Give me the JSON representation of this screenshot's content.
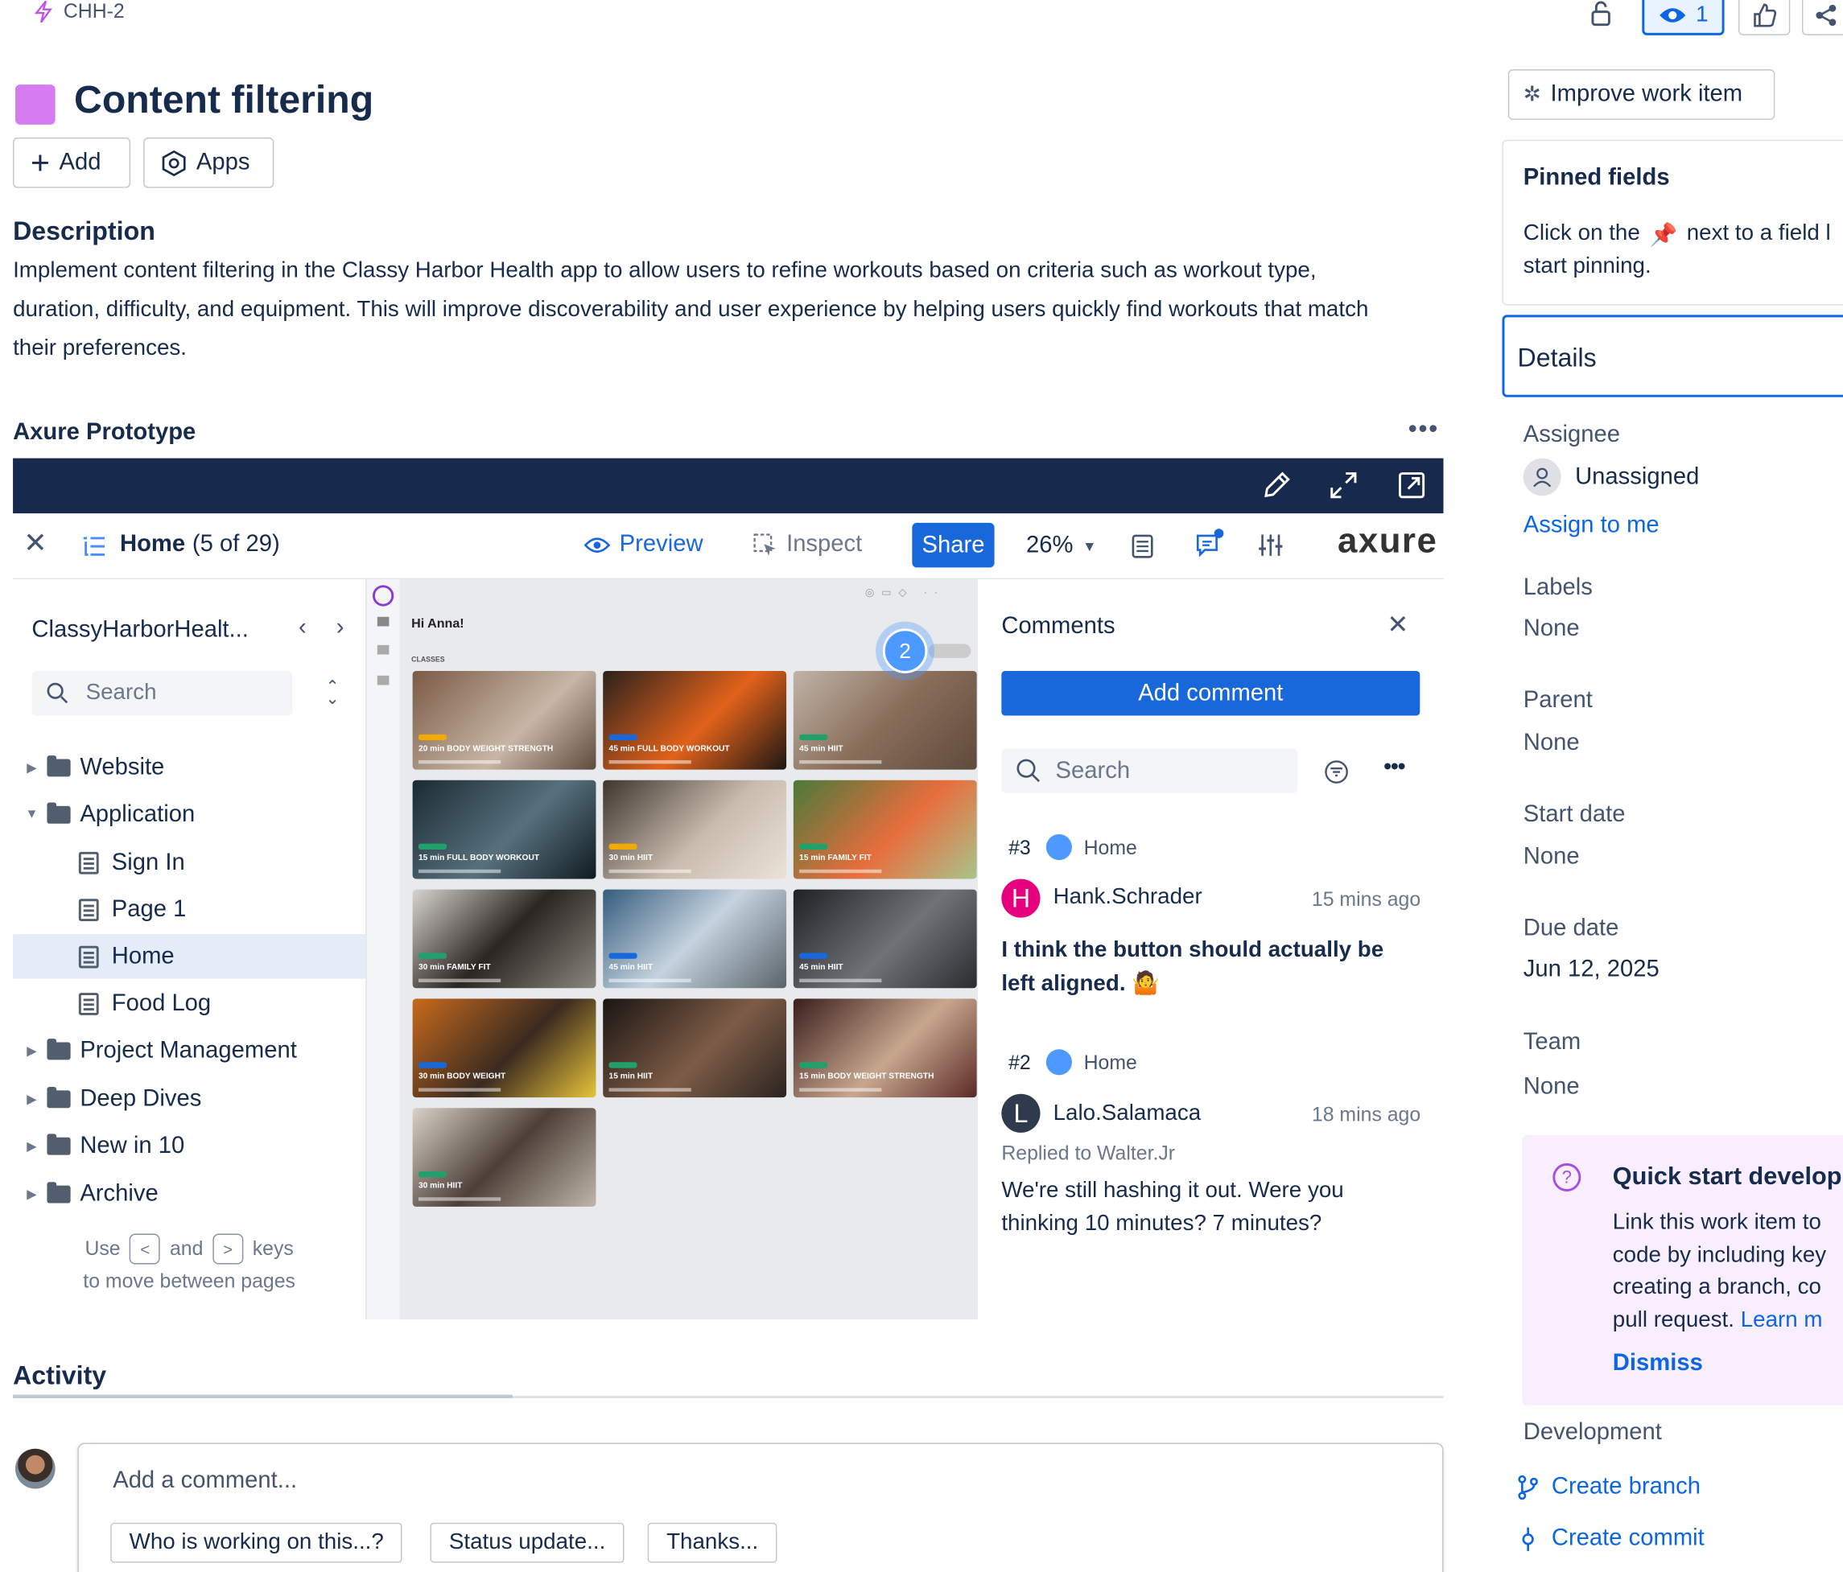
{
  "issue_key": "CHH-2",
  "title": "Content filtering",
  "toolbar": {
    "add_label": "Add",
    "apps_label": "Apps",
    "watch_count": "1",
    "improve_label": "Improve work item"
  },
  "description": {
    "heading": "Description",
    "body": "Implement content filtering in the Classy Harbor Health app to allow users to refine workouts based on criteria such as workout type, duration, difficulty, and equipment. This will improve discoverability and user experience by helping users quickly find workouts that match their preferences."
  },
  "prototype": {
    "heading": "Axure Prototype",
    "page_name": "Home",
    "page_count": "(5 of 29)",
    "preview_label": "Preview",
    "inspect_label": "Inspect",
    "share_label": "Share",
    "zoom": "26%",
    "brand": "axure",
    "project_name": "ClassyHarborHealt...",
    "search_placeholder": "Search",
    "tree": [
      {
        "label": "Website"
      },
      {
        "label": "Application"
      },
      {
        "label": "Sign In"
      },
      {
        "label": "Page 1"
      },
      {
        "label": "Home"
      },
      {
        "label": "Food Log"
      },
      {
        "label": "Project Management"
      },
      {
        "label": "Deep Dives"
      },
      {
        "label": "New in 10"
      },
      {
        "label": "Archive"
      }
    ],
    "hint_use": "Use",
    "hint_and": "and",
    "hint_keys": "keys",
    "hint_line2": "to move between pages",
    "canvas_greeting": "Hi Anna!",
    "canvas_section": "CLASSES",
    "marker_count": "2",
    "tiles": [
      {
        "label": "20 min  BODY WEIGHT STRENGTH"
      },
      {
        "label": "45 min  FULL BODY WORKOUT"
      },
      {
        "label": "45 min  HIIT"
      },
      {
        "label": "15 min  FULL BODY WORKOUT"
      },
      {
        "label": "30 min  HIIT"
      },
      {
        "label": "15 min  FAMILY FIT"
      },
      {
        "label": "30 min  FAMILY FIT"
      },
      {
        "label": "45 min  HIIT"
      },
      {
        "label": "45 min  HIIT"
      },
      {
        "label": "30 min  BODY WEIGHT"
      },
      {
        "label": "15 min  HIIT"
      },
      {
        "label": "15 min  BODY WEIGHT STRENGTH"
      },
      {
        "label": "30 min  HIIT"
      }
    ],
    "comments": {
      "heading": "Comments",
      "add_label": "Add comment",
      "search_placeholder": "Search",
      "items": [
        {
          "num": "#3",
          "page": "Home",
          "initial": "H",
          "author": "Hank.Schrader",
          "time": "15 mins ago",
          "replied": "",
          "text": "I think the button should actually be left aligned. 🤷"
        },
        {
          "num": "#2",
          "page": "Home",
          "initial": "L",
          "author": "Lalo.Salamaca",
          "time": "18 mins ago",
          "replied": "Replied to Walter.Jr",
          "text": "We're still hashing it out. Were you thinking 10 minutes? 7 minutes?"
        }
      ]
    }
  },
  "activity": {
    "heading": "Activity",
    "comment_placeholder": "Add a comment...",
    "quick_replies": [
      "Who is working on this...?",
      "Status update...",
      "Thanks..."
    ]
  },
  "pinned": {
    "heading": "Pinned fields",
    "text_before": "Click on the",
    "text_after": "next to a field l",
    "text_line2": "start pinning."
  },
  "details": {
    "heading": "Details",
    "assignee_label": "Assignee",
    "assignee_value": "Unassigned",
    "assign_to_me": "Assign to me",
    "labels_label": "Labels",
    "labels_value": "None",
    "parent_label": "Parent",
    "parent_value": "None",
    "start_label": "Start date",
    "start_value": "None",
    "due_label": "Due date",
    "due_value": "Jun 12, 2025",
    "team_label": "Team",
    "team_value": "None"
  },
  "quickstart": {
    "title": "Quick start develop",
    "line1": "Link this work item to",
    "line2": "code by including key",
    "line3": "creating a branch, co",
    "line4": "pull request.",
    "learn": "Learn m",
    "dismiss": "Dismiss"
  },
  "development": {
    "heading": "Development",
    "create_branch": "Create branch",
    "create_commit": "Create commit"
  },
  "colors": {
    "accent": "#0c66e4",
    "share": "#1868db",
    "prototype_bar": "#172a4d",
    "issue_type": "#d67bf0"
  }
}
